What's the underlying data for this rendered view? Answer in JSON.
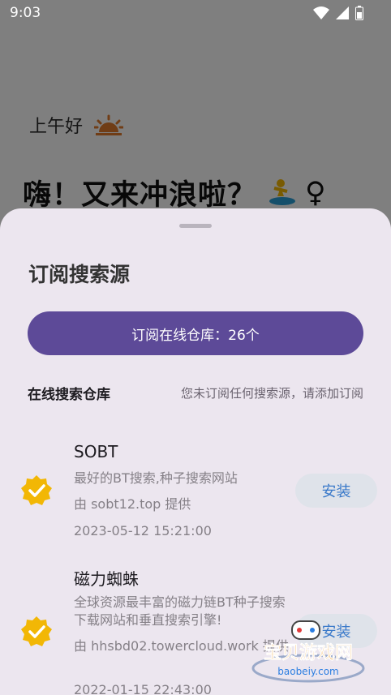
{
  "status_bar": {
    "time": "9:03"
  },
  "background": {
    "greeting": "上午好",
    "headline": "嗨！又来冲浪啦？",
    "headline_emoji_suffix": "♀"
  },
  "sheet": {
    "title": "订阅搜索源",
    "subscribe_button": "订阅在线仓库：26个",
    "section_title": "在线搜索仓库",
    "section_hint": "您未订阅任何搜索源，请添加订阅",
    "repos": [
      {
        "name": "SOBT",
        "description": "最好的BT搜索,种子搜索网站",
        "provider": "由 sobt12.top 提供",
        "date": "2023-05-12 15:21:00",
        "install_label": "安装"
      },
      {
        "name": "磁力蜘蛛",
        "description": "全球资源最丰富的磁力链BT种子搜索下载网站和垂直搜索引擎!",
        "provider": "由 hhsbd02.towercloud.work 提供",
        "date": "2022-01-15 22:43:00",
        "install_label": "安装"
      }
    ]
  },
  "watermark": {
    "title": "宝贝游戏网",
    "url": "baobeiy.com"
  },
  "colors": {
    "accent": "#5d4a98",
    "check": "#f2b705",
    "install_text": "#3a79c9",
    "sheet_bg": "#ece6ef"
  }
}
